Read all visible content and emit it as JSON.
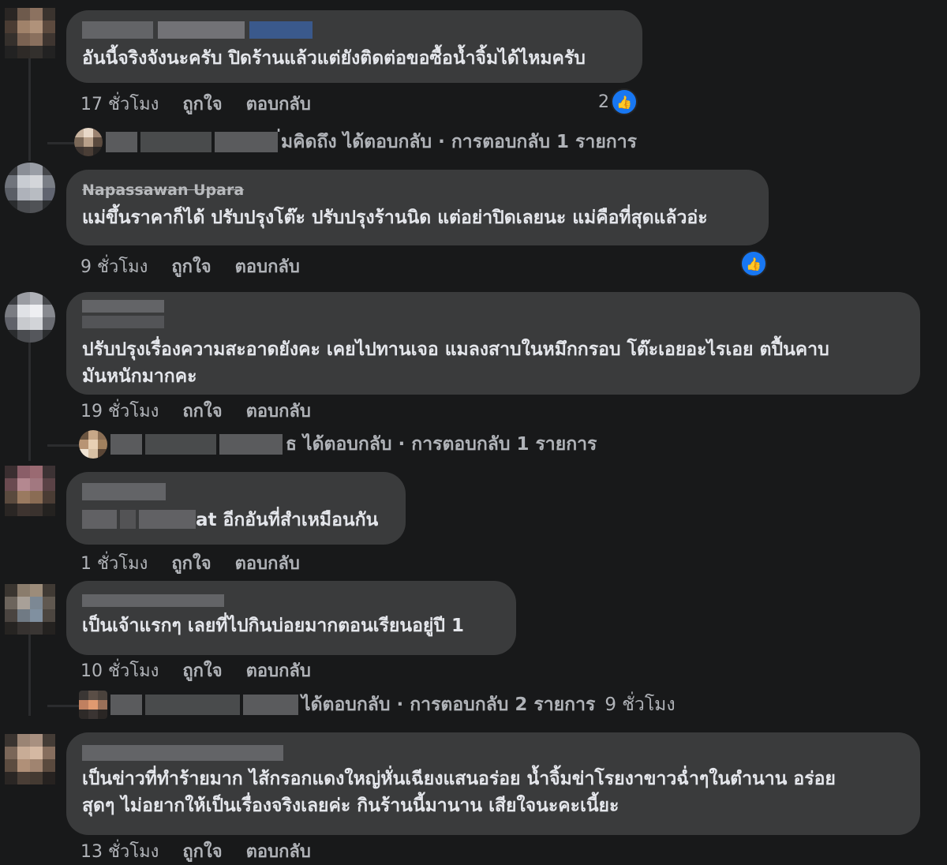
{
  "labels": {
    "like": "ถูกใจ",
    "reply": "ตอบกลับ"
  },
  "comments": [
    {
      "text": "อันนี้จริงจังนะครับ ปิดร้านแล้วแต่ยังติดต่อขอซื้อน้ำจิ้มได้ไหมครับ",
      "time": "17 ชั่วโมง",
      "like_label": "ถูกใจ",
      "reactions": "2"
    },
    {
      "author": "Napassawan Upara",
      "text": "แม่ขึ้นราคาก็ได้ ปรับปรุงโต๊ะ ปรับปรุงร้านนิด แต่อย่าปิดเลยนะ แม่คือที่สุดแล้วอ่ะ",
      "time": "9 ชั่วโมง",
      "like_label": "ถูกใจ"
    },
    {
      "text": "ปรับปรุงเรื่องความสะอาดยังคะ เคยไปทานเจอ แมลงสาบในหมึกกรอบ โต๊ะเอยอะไรเอย ตปื้นคาบ\nมันหนักมากคะ",
      "time": "19 ชั่วโมง",
      "like_label": "ถกใจ"
    },
    {
      "mention_suffix": "at",
      "text": " อีกอันที่สำเหมือนกัน",
      "time": "1 ชั่วโมง",
      "like_label": "ถูกใจ"
    },
    {
      "text": "เป็นเจ้าแรกๆ เลยที่ไปกินบ่อยมากตอนเรียนอยู่ปี 1",
      "time": "10 ชั่วโมง",
      "like_label": "ถูกใจ"
    },
    {
      "text": "เป็นข่าวที่ทำร้ายมาก ไส้กรอกแดงใหญ่หั่นเฉียงแสนอร่อย น้ำจิ้มข่าโรยงาขาวฉ่ำๆในตำนาน อร่อย\nสุดๆ ไม่อยากให้เป็นเรื่องจริงเลยค่ะ กินร้านนี้มานาน เสียใจนะคะเนี้ยะ",
      "time": "13 ชั่วโมง",
      "like_label": "ถูกใจ"
    }
  ],
  "replies": [
    {
      "text": "่มคิดถึง ได้ตอบกลับ · การตอบกลับ 1 รายการ"
    },
    {
      "text": "ธ ได้ตอบกลับ · การตอบกลับ 1 รายการ"
    },
    {
      "text": "ได้ตอบกลับ · การตอบกลับ 2 รายการ",
      "time": "9 ชั่วโมง"
    }
  ],
  "colors": {
    "background": "#18191a",
    "bubble": "#3a3b3c",
    "text": "#e4e6eb",
    "meta_text": "#b0b3b8",
    "like_blue": "#1877f2"
  },
  "icons": {
    "like": "thumbs-up-icon"
  }
}
